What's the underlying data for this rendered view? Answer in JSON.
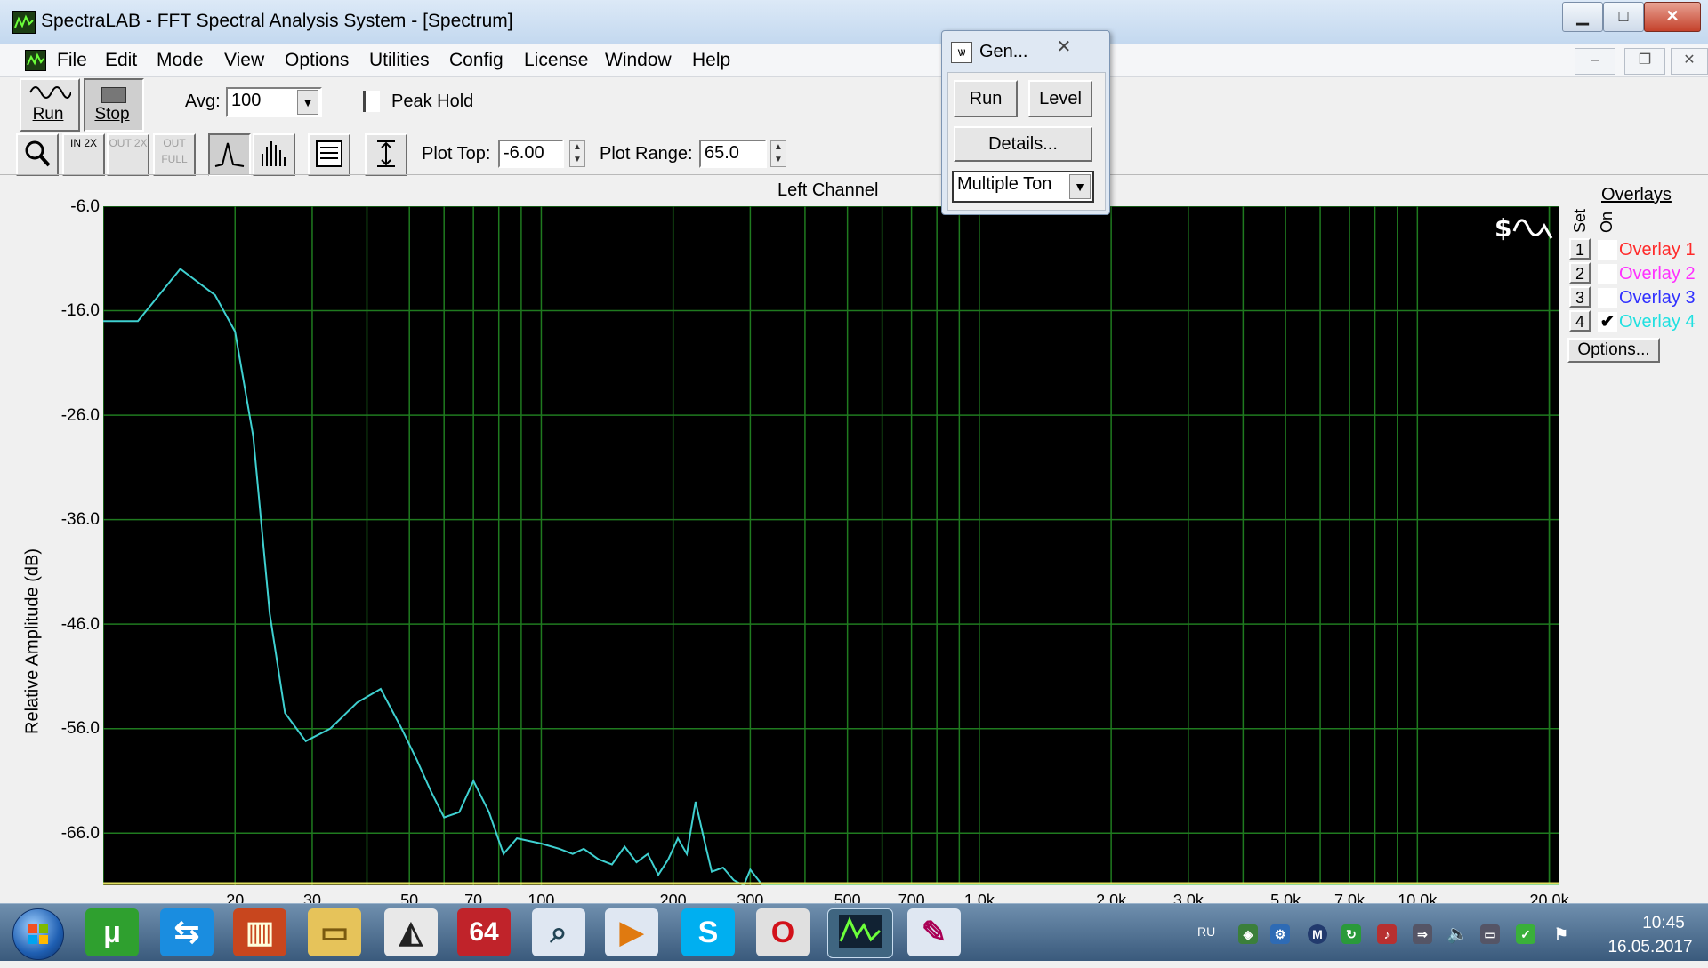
{
  "window": {
    "title": "SpectraLAB - FFT Spectral Analysis System - [Spectrum]",
    "controls": {
      "minimize": "▁",
      "maximize": "□",
      "close": "✕"
    }
  },
  "menu": [
    "File",
    "Edit",
    "Mode",
    "View",
    "Options",
    "Utilities",
    "Config",
    "License",
    "Window",
    "Help"
  ],
  "mdi_controls": {
    "minimize": "–",
    "restore": "❐",
    "close": "✕"
  },
  "toolbar1": {
    "run_label": "Run",
    "stop_label": "Stop",
    "avg_label": "Avg:",
    "avg_value": "100",
    "peak_hold_label": "Peak Hold",
    "peak_hold_checked": false
  },
  "toolbar2": {
    "zoom_in_label": "IN 2X",
    "zoom_out_label": "OUT 2X",
    "zoom_full_label": "OUT FULL",
    "plot_top_label": "Plot Top:",
    "plot_top_value": "-6.00",
    "plot_range_label": "Plot Range:",
    "plot_range_value": "65.0"
  },
  "generator": {
    "title": "Gen...",
    "close_glyph": "✕",
    "run_label": "Run",
    "level_label": "Level",
    "details_label": "Details...",
    "mode_value": "Multiple Ton"
  },
  "plot": {
    "title": "Left Channel",
    "y_label": "Relative Amplitude (dB)",
    "y_ticks": [
      "-6.0",
      "-16.0",
      "-26.0",
      "-36.0",
      "-46.0",
      "-56.0",
      "-66.0"
    ],
    "x_ticks": [
      "20",
      "30",
      "50",
      "70",
      "100",
      "200",
      "300",
      "500",
      "700",
      "1.0k",
      "2.0k",
      "3.0k",
      "5.0k",
      "7.0k",
      "10.0k",
      "20.0k"
    ]
  },
  "chart_data": {
    "type": "line",
    "title": "Left Channel",
    "xlabel": "",
    "ylabel": "Relative Amplitude (dB)",
    "x_scale": "log",
    "xlim": [
      10,
      21000
    ],
    "ylim": [
      -71,
      -6
    ],
    "grid": true,
    "series": [
      {
        "color": "#3fd0d0",
        "x": [
          10,
          12,
          15,
          18,
          20,
          22,
          24,
          26,
          29,
          33,
          38,
          43,
          48,
          52,
          56,
          60,
          65,
          70,
          76,
          82,
          88,
          95,
          100,
          110,
          118,
          125,
          135,
          145,
          155,
          165,
          175,
          185,
          195,
          205,
          215,
          225,
          235,
          245,
          260,
          275,
          290,
          300,
          320,
          350,
          400,
          500,
          21000
        ],
        "y": [
          -17,
          -17,
          -12,
          -14.5,
          -18,
          -28,
          -45,
          -54.5,
          -57.2,
          -56,
          -53.5,
          -52.2,
          -56,
          -59,
          -62,
          -64.5,
          -64,
          -61,
          -64,
          -68,
          -66.5,
          -66.8,
          -67,
          -67.5,
          -68,
          -67.5,
          -68.5,
          -69,
          -67.3,
          -68.8,
          -68,
          -70,
          -68.5,
          -66.5,
          -68,
          -63,
          -66.5,
          -69.7,
          -69.3,
          -70.5,
          -71,
          -69.5,
          -71,
          -71,
          -71,
          -71,
          -71
        ]
      }
    ]
  },
  "overlays": {
    "title": "Overlays",
    "col_set": "Set",
    "col_on": "On",
    "items": [
      {
        "set": "1",
        "label": "Overlay 1",
        "color": "#ff2a2a",
        "on": false
      },
      {
        "set": "2",
        "label": "Overlay 2",
        "color": "#ff30ff",
        "on": false
      },
      {
        "set": "3",
        "label": "Overlay 3",
        "color": "#3030ff",
        "on": false
      },
      {
        "set": "4",
        "label": "Overlay 4",
        "color": "#20e0e0",
        "on": true
      }
    ],
    "options_label": "Options..."
  },
  "taskbar": {
    "lang": "RU",
    "time": "10:45",
    "date": "16.05.2017"
  }
}
